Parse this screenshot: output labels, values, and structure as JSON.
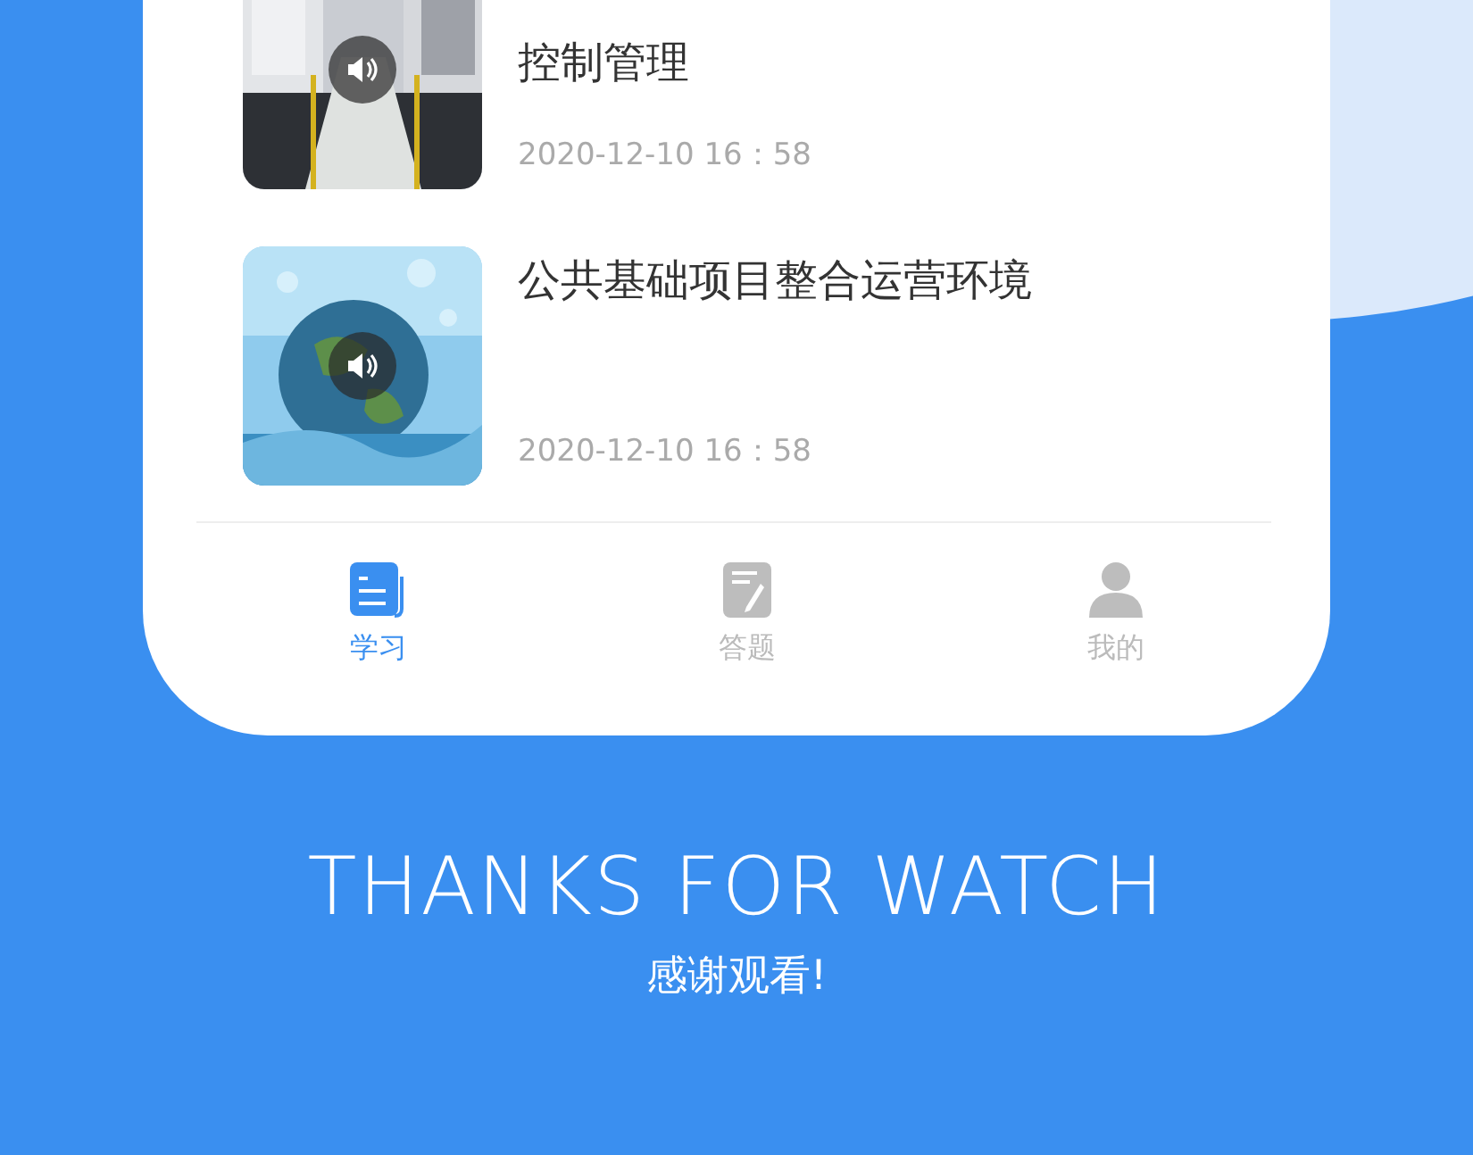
{
  "list": [
    {
      "title": "控制管理",
      "date": "2020-12-10 16：58"
    },
    {
      "title": "公共基础项目整合运营环境",
      "date": "2020-12-10 16：58"
    }
  ],
  "tabs": [
    {
      "label": "学习",
      "selected": true,
      "kind": "news"
    },
    {
      "label": "答题",
      "selected": false,
      "kind": "note"
    },
    {
      "label": "我的",
      "selected": false,
      "kind": "person"
    }
  ],
  "footer": {
    "title": "THANKS FOR WATCH",
    "subtitle": "感谢观看!"
  }
}
